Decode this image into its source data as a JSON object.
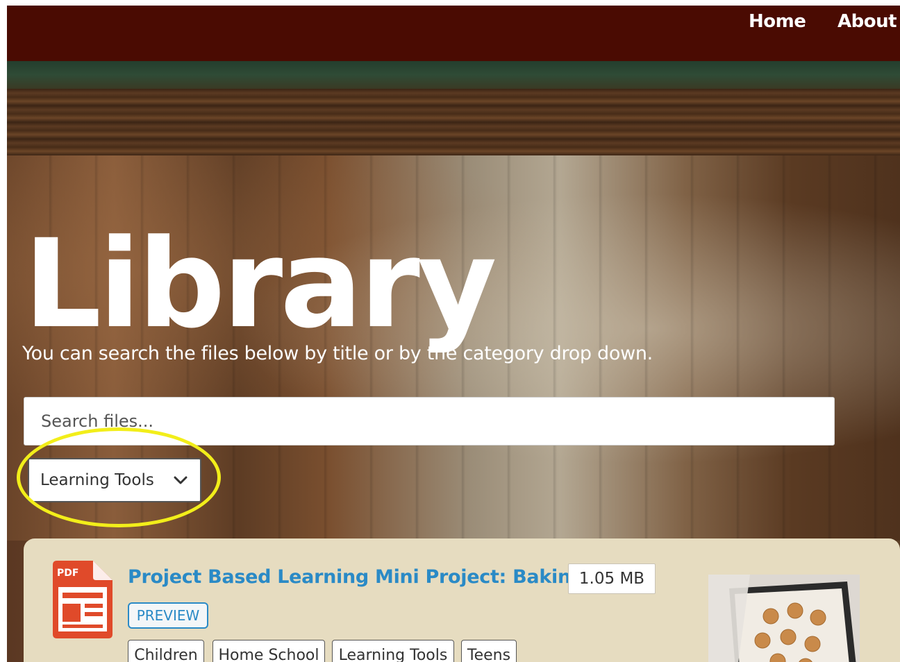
{
  "nav": {
    "links": [
      {
        "label": "Home"
      },
      {
        "label": "About"
      }
    ]
  },
  "hero": {
    "title": "Library",
    "subtitle": "You can search the files below by title or by the category drop down."
  },
  "search": {
    "placeholder": "Search files...",
    "value": ""
  },
  "category": {
    "selected": "Learning Tools"
  },
  "files": [
    {
      "icon": "pdf-icon",
      "icon_label": "PDF",
      "title": "Project Based Learning Mini Project: Baking",
      "size": "1.05 MB",
      "preview_label": "PREVIEW",
      "tags": [
        "Children",
        "Home School",
        "Learning Tools",
        "Teens"
      ],
      "thumbnail": "baking-cookies-thumbnail"
    }
  ],
  "colors": {
    "navbar": "#4a0b02",
    "link": "#2a8ac6",
    "card": "#e6dcc0",
    "highlight": "#f2ee1a",
    "pdf": "#e04a2a"
  }
}
